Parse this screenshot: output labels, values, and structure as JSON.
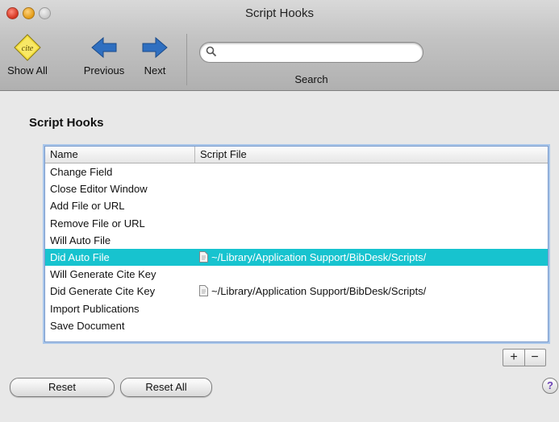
{
  "window": {
    "title": "Script Hooks"
  },
  "toolbar": {
    "show_all_label": "Show All",
    "cite_badge": "cite",
    "previous_label": "Previous",
    "next_label": "Next",
    "search_label": "Search",
    "search_value": "",
    "search_placeholder": ""
  },
  "section": {
    "title": "Script Hooks"
  },
  "table": {
    "columns": [
      "Name",
      "Script File"
    ],
    "rows": [
      {
        "name": "Change Field",
        "file": ""
      },
      {
        "name": "Close Editor Window",
        "file": ""
      },
      {
        "name": "Add File or URL",
        "file": ""
      },
      {
        "name": "Remove File or URL",
        "file": ""
      },
      {
        "name": "Will Auto File",
        "file": ""
      },
      {
        "name": "Did Auto File",
        "file": "~/Library/Application Support/BibDesk/Scripts/",
        "selected": true
      },
      {
        "name": "Will Generate Cite Key",
        "file": ""
      },
      {
        "name": "Did Generate Cite Key",
        "file": "~/Library/Application Support/BibDesk/Scripts/"
      },
      {
        "name": "Import Publications",
        "file": ""
      },
      {
        "name": "Save Document",
        "file": ""
      }
    ]
  },
  "controls": {
    "add_label": "+",
    "remove_label": "−"
  },
  "footer": {
    "reset_label": "Reset",
    "reset_all_label": "Reset All",
    "help_label": "?"
  },
  "colors": {
    "selection": "#17c3cf",
    "arrow_blue": "#2f6fc0",
    "focus_ring": "#a9c6ea"
  }
}
